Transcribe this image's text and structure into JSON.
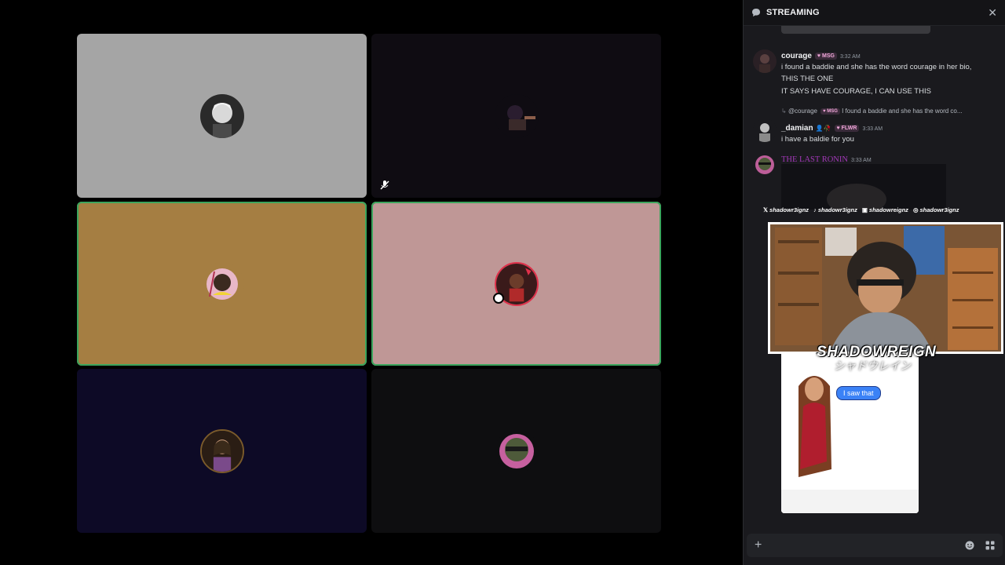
{
  "panel": {
    "title": "STREAMING",
    "close": "✕"
  },
  "messages": [
    {
      "user": "courage",
      "badge": "MSG",
      "time": "3:32 AM",
      "lines": [
        "i found a baddie and she has the word courage in her bio,",
        "THIS THE ONE",
        "IT SAYS HAVE COURAGE, I CAN USE THIS"
      ]
    },
    {
      "reply_to": "@courage",
      "reply_badge": "MSG",
      "reply_text": "I found a baddie and she has the word co...",
      "user": "_damian",
      "badge": "FLWR",
      "time": "3:33 AM",
      "lines": [
        "i have a baldie for you"
      ]
    },
    {
      "user": "THE LAST RONIN",
      "time": "3:33 AM"
    }
  ],
  "gif": {
    "bubble": "I saw that"
  },
  "overlay": {
    "socials": [
      {
        "icon": "x-icon",
        "glyph": "𝕏",
        "handle": "shadowr3ignz"
      },
      {
        "icon": "tiktok-icon",
        "glyph": "♪",
        "handle": "shadowr3ignz"
      },
      {
        "icon": "twitch-icon",
        "glyph": "▣",
        "handle": "shadowreignz"
      },
      {
        "icon": "instagram-icon",
        "glyph": "◎",
        "handle": "shadowr3ignz"
      }
    ],
    "logo": "SHADOWREIGN",
    "logo_sub": "シャドウレイン"
  },
  "colors": {
    "speaking_outline": "#3ba55d",
    "tile_1": "#a5a5a5",
    "tile_2": "#0f0c12",
    "tile_3": "#a57e42",
    "tile_4": "#bf9796",
    "tile_5": "#0d0a26",
    "tile_6": "#0e0e10",
    "ronin_name": "#a238b8"
  }
}
